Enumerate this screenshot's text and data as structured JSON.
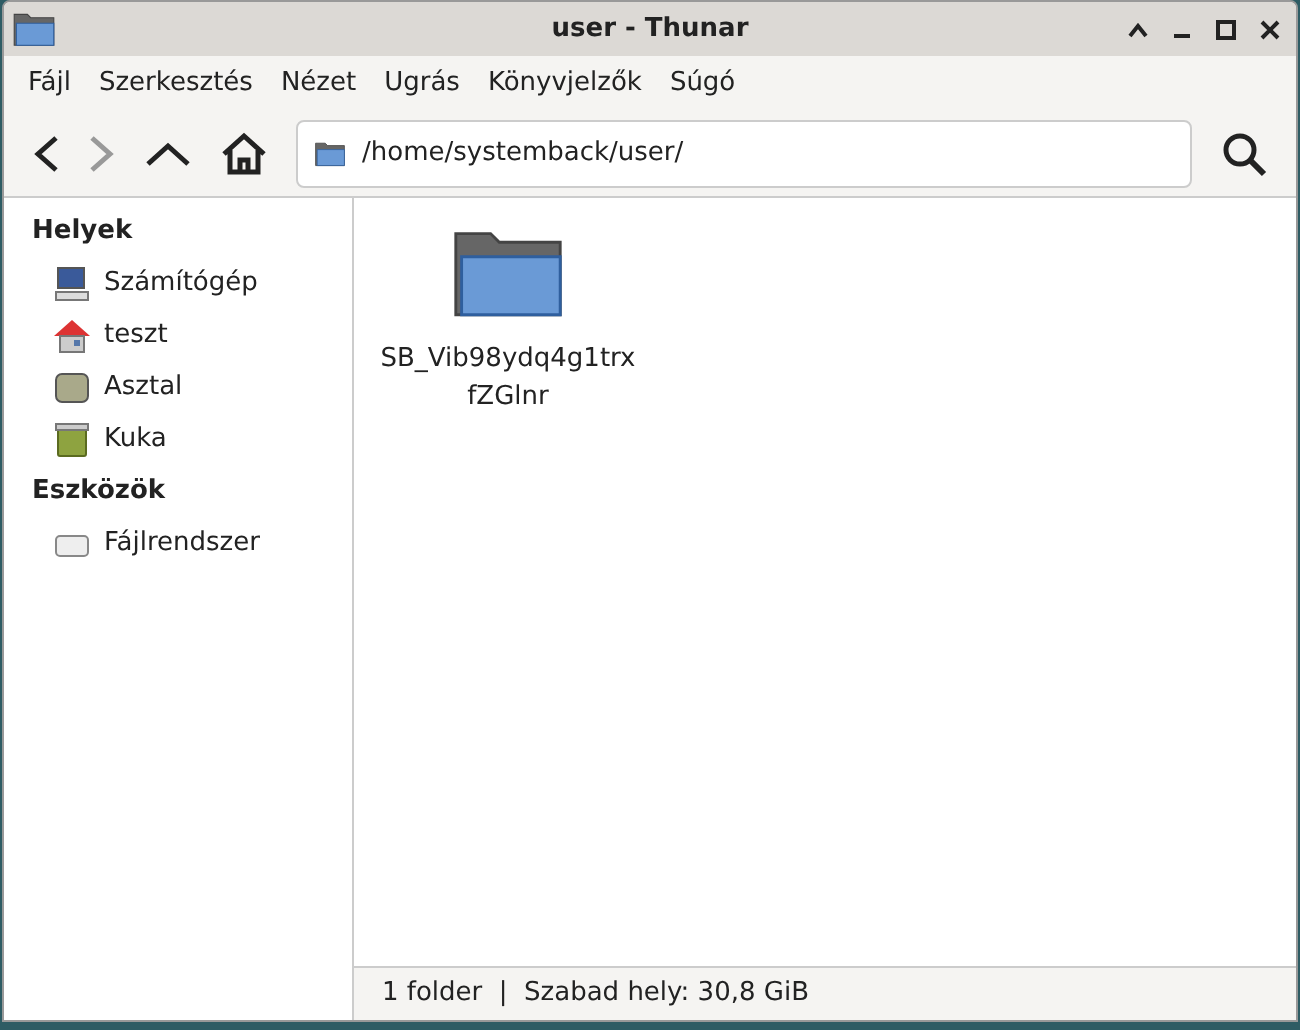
{
  "window": {
    "title": "user - Thunar"
  },
  "menu": [
    "Fájl",
    "Szerkesztés",
    "Nézet",
    "Ugrás",
    "Könyvjelzők",
    "Súgó"
  ],
  "toolbar": {
    "back_disabled": false,
    "forward_disabled": true,
    "location": "/home/systemback/user/"
  },
  "sidebar": [
    {
      "heading": "Helyek",
      "items": [
        {
          "label": "Számítógép",
          "kind": "computer"
        },
        {
          "label": "teszt",
          "kind": "home"
        },
        {
          "label": "Asztal",
          "kind": "desktop"
        },
        {
          "label": "Kuka",
          "kind": "trash"
        }
      ]
    },
    {
      "heading": "Eszközök",
      "items": [
        {
          "label": "Fájlrendszer",
          "kind": "drive"
        }
      ]
    }
  ],
  "files": [
    {
      "name": "SB_Vib98ydq4g1trx fZGlnr"
    }
  ],
  "status_bar": "1 folder  |  Szabad hely: 30,8 GiB"
}
